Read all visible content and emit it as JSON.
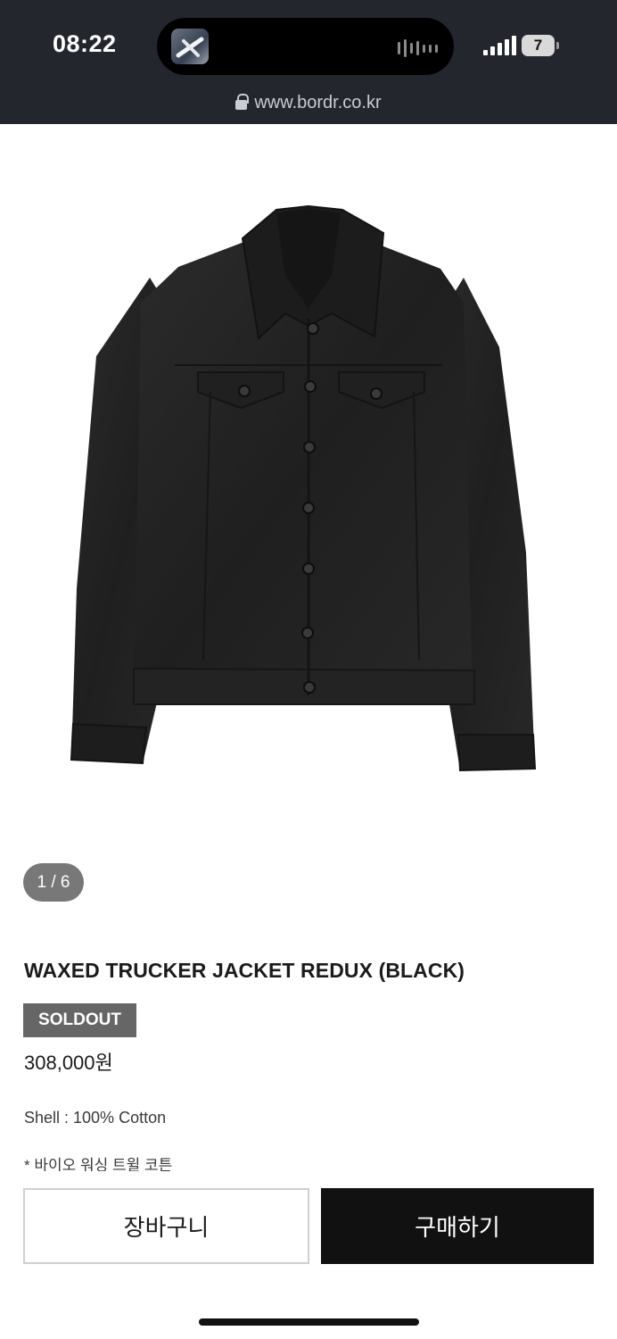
{
  "status_bar": {
    "time": "08:22",
    "battery": "7",
    "url": "www.bordr.co.kr"
  },
  "gallery": {
    "pager": "1 / 6"
  },
  "product": {
    "title": "WAXED TRUCKER JACKET REDUX (BLACK)",
    "status_badge": "SOLDOUT",
    "price": "308,000원",
    "spec": "Shell : 100% Cotton",
    "note": "* 바이오 워싱 트윌 코튼"
  },
  "actions": {
    "cart_label": "장바구니",
    "buy_label": "구매하기"
  },
  "colors": {
    "chrome_bg": "#23262d",
    "badge_bg": "#666666",
    "buy_bg": "#111111"
  }
}
